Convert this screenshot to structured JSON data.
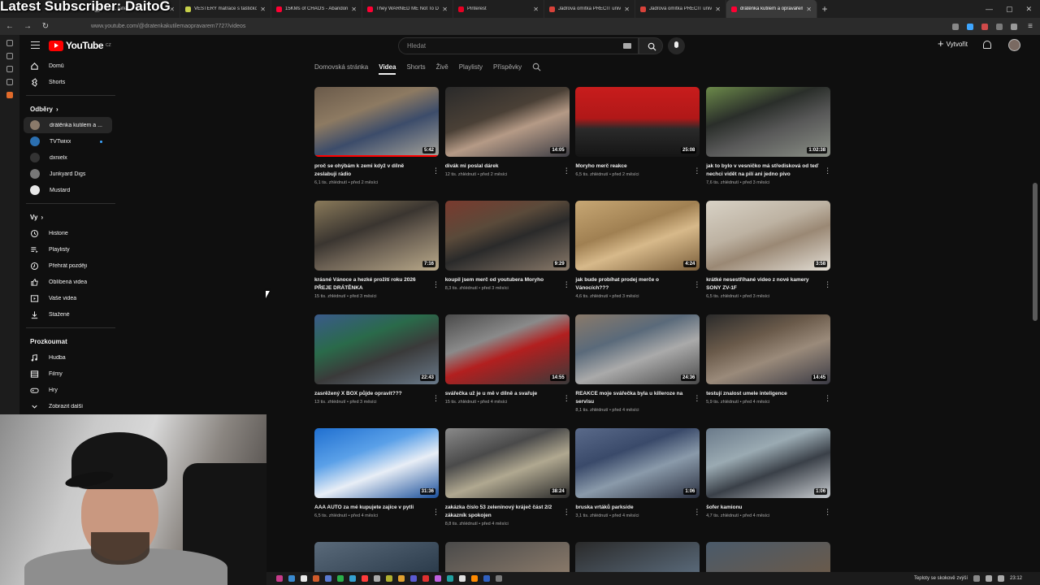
{
  "overlay": {
    "name": "Latest Subscriber: DaitoG"
  },
  "browser": {
    "tabs": [
      {
        "title": "Track, falle",
        "color": "#888888",
        "active": false
      },
      {
        "title": "VESTERÝ matrace s taštičkový",
        "color": "#c7d04a",
        "active": false
      },
      {
        "title": "15KMs of CHAOS - Abandoned",
        "color": "#ff0033",
        "active": false
      },
      {
        "title": "They WARNED ME Not To Do It",
        "color": "#ff0033",
        "active": false
      },
      {
        "title": "Pinterest",
        "color": "#e60023",
        "active": false
      },
      {
        "title": "Jádrová omítka PRECIT univerzá",
        "color": "#d9423a",
        "active": false
      },
      {
        "title": "Jádrová omítka PRECIT univerzá",
        "color": "#d9423a",
        "active": false
      },
      {
        "title": "drátěnka kutilem a opravářem",
        "color": "#ff0033",
        "active": true
      }
    ],
    "url": "www.youtube.com/@dratenkakutilemaopravarem7727/videos"
  },
  "youtube": {
    "logo": "YouTube",
    "region": "CZ",
    "search_placeholder": "Hledat",
    "create_label": "Vytvořit"
  },
  "sidebar": {
    "main": [
      {
        "label": "Domů",
        "icon": "home-icon"
      },
      {
        "label": "Shorts",
        "icon": "shorts-icon"
      }
    ],
    "subs_header": "Odběry",
    "subscriptions": [
      {
        "label": "drátěnka kutilem a ...",
        "color": "#8a7a6a",
        "active": true,
        "dot": false
      },
      {
        "label": "TVTwixx",
        "color": "#2b6fb0",
        "active": false,
        "dot": true
      },
      {
        "label": "dxnielx",
        "color": "#333333",
        "active": false,
        "dot": false
      },
      {
        "label": "Junkyard Digs",
        "color": "#777777",
        "active": false,
        "dot": false
      },
      {
        "label": "Mustard",
        "color": "#e8e8e8",
        "active": false,
        "dot": false
      }
    ],
    "you_header": "Vy",
    "you": [
      {
        "label": "Historie",
        "icon": "history-icon"
      },
      {
        "label": "Playlisty",
        "icon": "playlists-icon"
      },
      {
        "label": "Přehrát později",
        "icon": "watch-later-icon"
      },
      {
        "label": "Oblíbená videa",
        "icon": "like-icon"
      },
      {
        "label": "Vaše videa",
        "icon": "your-videos-icon"
      },
      {
        "label": "Stažené",
        "icon": "download-icon"
      }
    ],
    "explore_header": "Prozkoumat",
    "explore": [
      {
        "label": "Hudba",
        "icon": "music-icon"
      },
      {
        "label": "Filmy",
        "icon": "movies-icon"
      },
      {
        "label": "Hry",
        "icon": "games-icon"
      },
      {
        "label": "Zobrazit další",
        "icon": "chevron-down-icon"
      }
    ]
  },
  "channel_tabs": [
    "Domovská stránka",
    "Videa",
    "Shorts",
    "Živě",
    "Playlisty",
    "Příspěvky"
  ],
  "active_tab": "Videa",
  "videos": [
    {
      "title": "proč se ohýbám k zemi když v dílně zeslabuji rádio",
      "meta": "6,1 tis. zhlédnutí • před 2 měsíci",
      "duration": "5:42",
      "bg": "linear-gradient(160deg,#6a5a4a 0%,#8d7a62 35%,#3c4c6a 60%,#a6a39a 100%)",
      "progress": 1.0
    },
    {
      "title": "divák mi poslal dárek",
      "meta": "12 tis. zhlédnutí • před 2 měsíci",
      "duration": "14:05",
      "bg": "linear-gradient(160deg,#2a2a2a 0%,#4a4036 40%,#b59a86 60%,#3d3d44 100%)",
      "progress": 0
    },
    {
      "title": "Moryho merč reakce",
      "meta": "6,5 tis. zhlédnutí • před 2 měsíci",
      "duration": "25:08",
      "bg": "linear-gradient(180deg,#c81c1c 0%,#b01818 45%,#2a2a2a 60%,#151515 100%)",
      "progress": 0
    },
    {
      "title": "jak to bylo v vesničko má středisková od teď nechci vidět na pilí ani jedno pivo",
      "meta": "7,6 tis. zhlédnutí • před 3 měsíci",
      "duration": "1:02:38",
      "bg": "linear-gradient(160deg,#6c8a4a 0%,#2a2e2a 35%,#585858 60%,#8a8f86 100%)",
      "progress": 0
    },
    {
      "title": "krásné Vánoce a hezké prožití roku 2026 PŘEJE DRÁTĚNKA",
      "meta": "15 tis. zhlédnutí • před 3 měsíci",
      "duration": "7:16",
      "bg": "linear-gradient(160deg,#8a7a5a 0%,#3a3530 40%,#6a5f52 60%,#b9a98a 100%)",
      "progress": 0
    },
    {
      "title": "koupil jsem merč od youtubera Moryho",
      "meta": "8,3 tis. zhlédnutí • před 3 měsíci",
      "duration": "9:29",
      "bg": "linear-gradient(160deg,#7a3a2e 0%,#5a4a3a 35%,#2a2a2a 55%,#8a7a6a 100%)",
      "progress": 0
    },
    {
      "title": "jak bude probíhat prodej merče o Vánocích???",
      "meta": "4,6 tis. zhlédnutí • před 3 měsíci",
      "duration": "4:24",
      "bg": "linear-gradient(160deg,#c7a774 0%,#a08052 40%,#d7b98a 60%,#7a5e3a 100%)",
      "progress": 0
    },
    {
      "title": "krátké nesestříhané video z nové kamery SONY ZV-1F",
      "meta": "6,5 tis. zhlédnutí • před 3 měsíci",
      "duration": "3:58",
      "bg": "linear-gradient(160deg,#d8d2c6 0%,#bdb2a2 40%,#9a8874 60%,#e2ddd4 100%)",
      "progress": 0
    },
    {
      "title": "zasrěžený X BOX půjde opravit???",
      "meta": "13 tis. zhlédnutí • před 3 měsíci",
      "duration": "22:43",
      "bg": "linear-gradient(160deg,#3a5a8a 0%,#2a6a4a 35%,#3a3a3a 60%,#6a7a8a 100%)",
      "progress": 0
    },
    {
      "title": "svářečka už je u mě v dílně a svařuje",
      "meta": "15 tis. zhlédnutí • před 4 měsíci",
      "duration": "14:55",
      "bg": "linear-gradient(160deg,#4a4a4a 0%,#8a8a8a 35%,#b21f1f 55%,#3a3a3a 100%)",
      "progress": 0
    },
    {
      "title": "REAKCE moje svářečka byla u killeroze na servisu",
      "meta": "8,1 tis. zhlédnutí • před 4 měsíci",
      "duration": "24:36",
      "bg": "linear-gradient(160deg,#8a7a6a 0%,#5a6a7a 35%,#aaaaaa 60%,#4a4a4a 100%)",
      "progress": 0
    },
    {
      "title": "testují znalost umele inteligence",
      "meta": "5,9 tis. zhlédnutí • před 4 měsíci",
      "duration": "14:45",
      "bg": "linear-gradient(160deg,#2a2a2a 0%,#6a5a4a 35%,#9a8a7a 60%,#3a3a44 100%)",
      "progress": 0
    },
    {
      "title": "AAA AUTO za mé kupujete zajíce v pytli",
      "meta": "6,5 tis. zhlédnutí • před 4 měsíci",
      "duration": "31:36",
      "bg": "linear-gradient(160deg,#1f6fd0 0%,#5aa0e8 35%,#e8eef6 60%,#1a4f9a 100%)",
      "progress": 0
    },
    {
      "title": "zakázka číslo 53 zeleninový kráječ část 2/2 zákazník spokojen",
      "meta": "8,8 tis. zhlédnutí • před 4 měsíci",
      "duration": "38:24",
      "bg": "linear-gradient(160deg,#8a8a8a 0%,#4a4a4a 35%,#b0a890 60%,#2a2a2a 100%)",
      "progress": 0
    },
    {
      "title": "bruska vrtáků parkside",
      "meta": "3,1 tis. zhlédnutí • před 4 měsíci",
      "duration": "1:06",
      "bg": "linear-gradient(160deg,#5a6a8a 0%,#3a4a6a 35%,#8a9aaa 60%,#2a3040 100%)",
      "progress": 0
    },
    {
      "title": "šofer kamionu",
      "meta": "4,7 tis. zhlédnutí • před 4 měsíci",
      "duration": "1:06",
      "bg": "linear-gradient(160deg,#6a7a8a 0%,#9aaab2 35%,#3a4048 60%,#c8ccd0 100%)",
      "progress": 0
    }
  ],
  "partial_row": [
    {
      "bg": "linear-gradient(160deg,#5a6a7a 0%,#2a3a4a 100%)"
    },
    {
      "bg": "linear-gradient(160deg,#4a4a4a 0%,#8a7a6a 100%)"
    },
    {
      "bg": "linear-gradient(160deg,#2a2a2a 0%,#5a6a7a 100%)"
    },
    {
      "bg": "linear-gradient(160deg,#4a5a6a 0%,#6a5a4a 100%)"
    }
  ],
  "taskbar": {
    "weather": "Teploty se skokově zvýší",
    "time": "23:12"
  }
}
